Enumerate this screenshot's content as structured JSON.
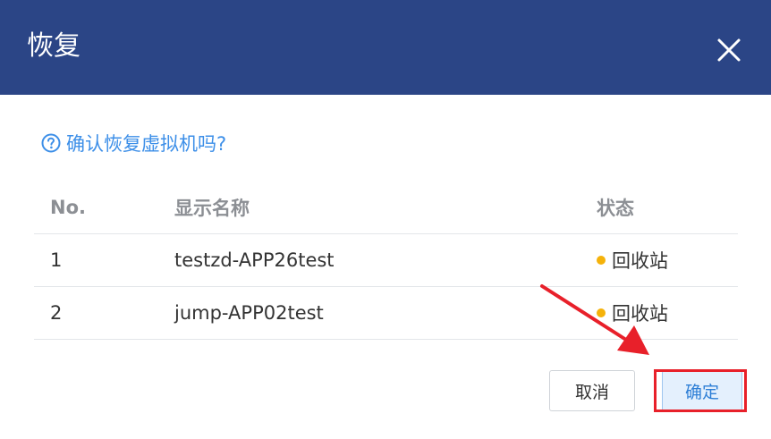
{
  "dialog": {
    "title": "恢复",
    "close_icon": "close-icon",
    "question": "确认恢复虚拟机吗?",
    "question_icon": "question-circle-icon"
  },
  "table": {
    "headers": {
      "no": "No.",
      "name": "显示名称",
      "status": "状态"
    },
    "rows": [
      {
        "no": "1",
        "name": "testzd-APP26test",
        "status": "回收站",
        "status_color": "#f5b20a"
      },
      {
        "no": "2",
        "name": "jump-APP02test",
        "status": "回收站",
        "status_color": "#f5b20a"
      }
    ]
  },
  "buttons": {
    "cancel": "取消",
    "confirm": "确定"
  },
  "colors": {
    "header_bg": "#2b4586",
    "accent": "#3d8fe8",
    "annotation": "#e8202a"
  }
}
